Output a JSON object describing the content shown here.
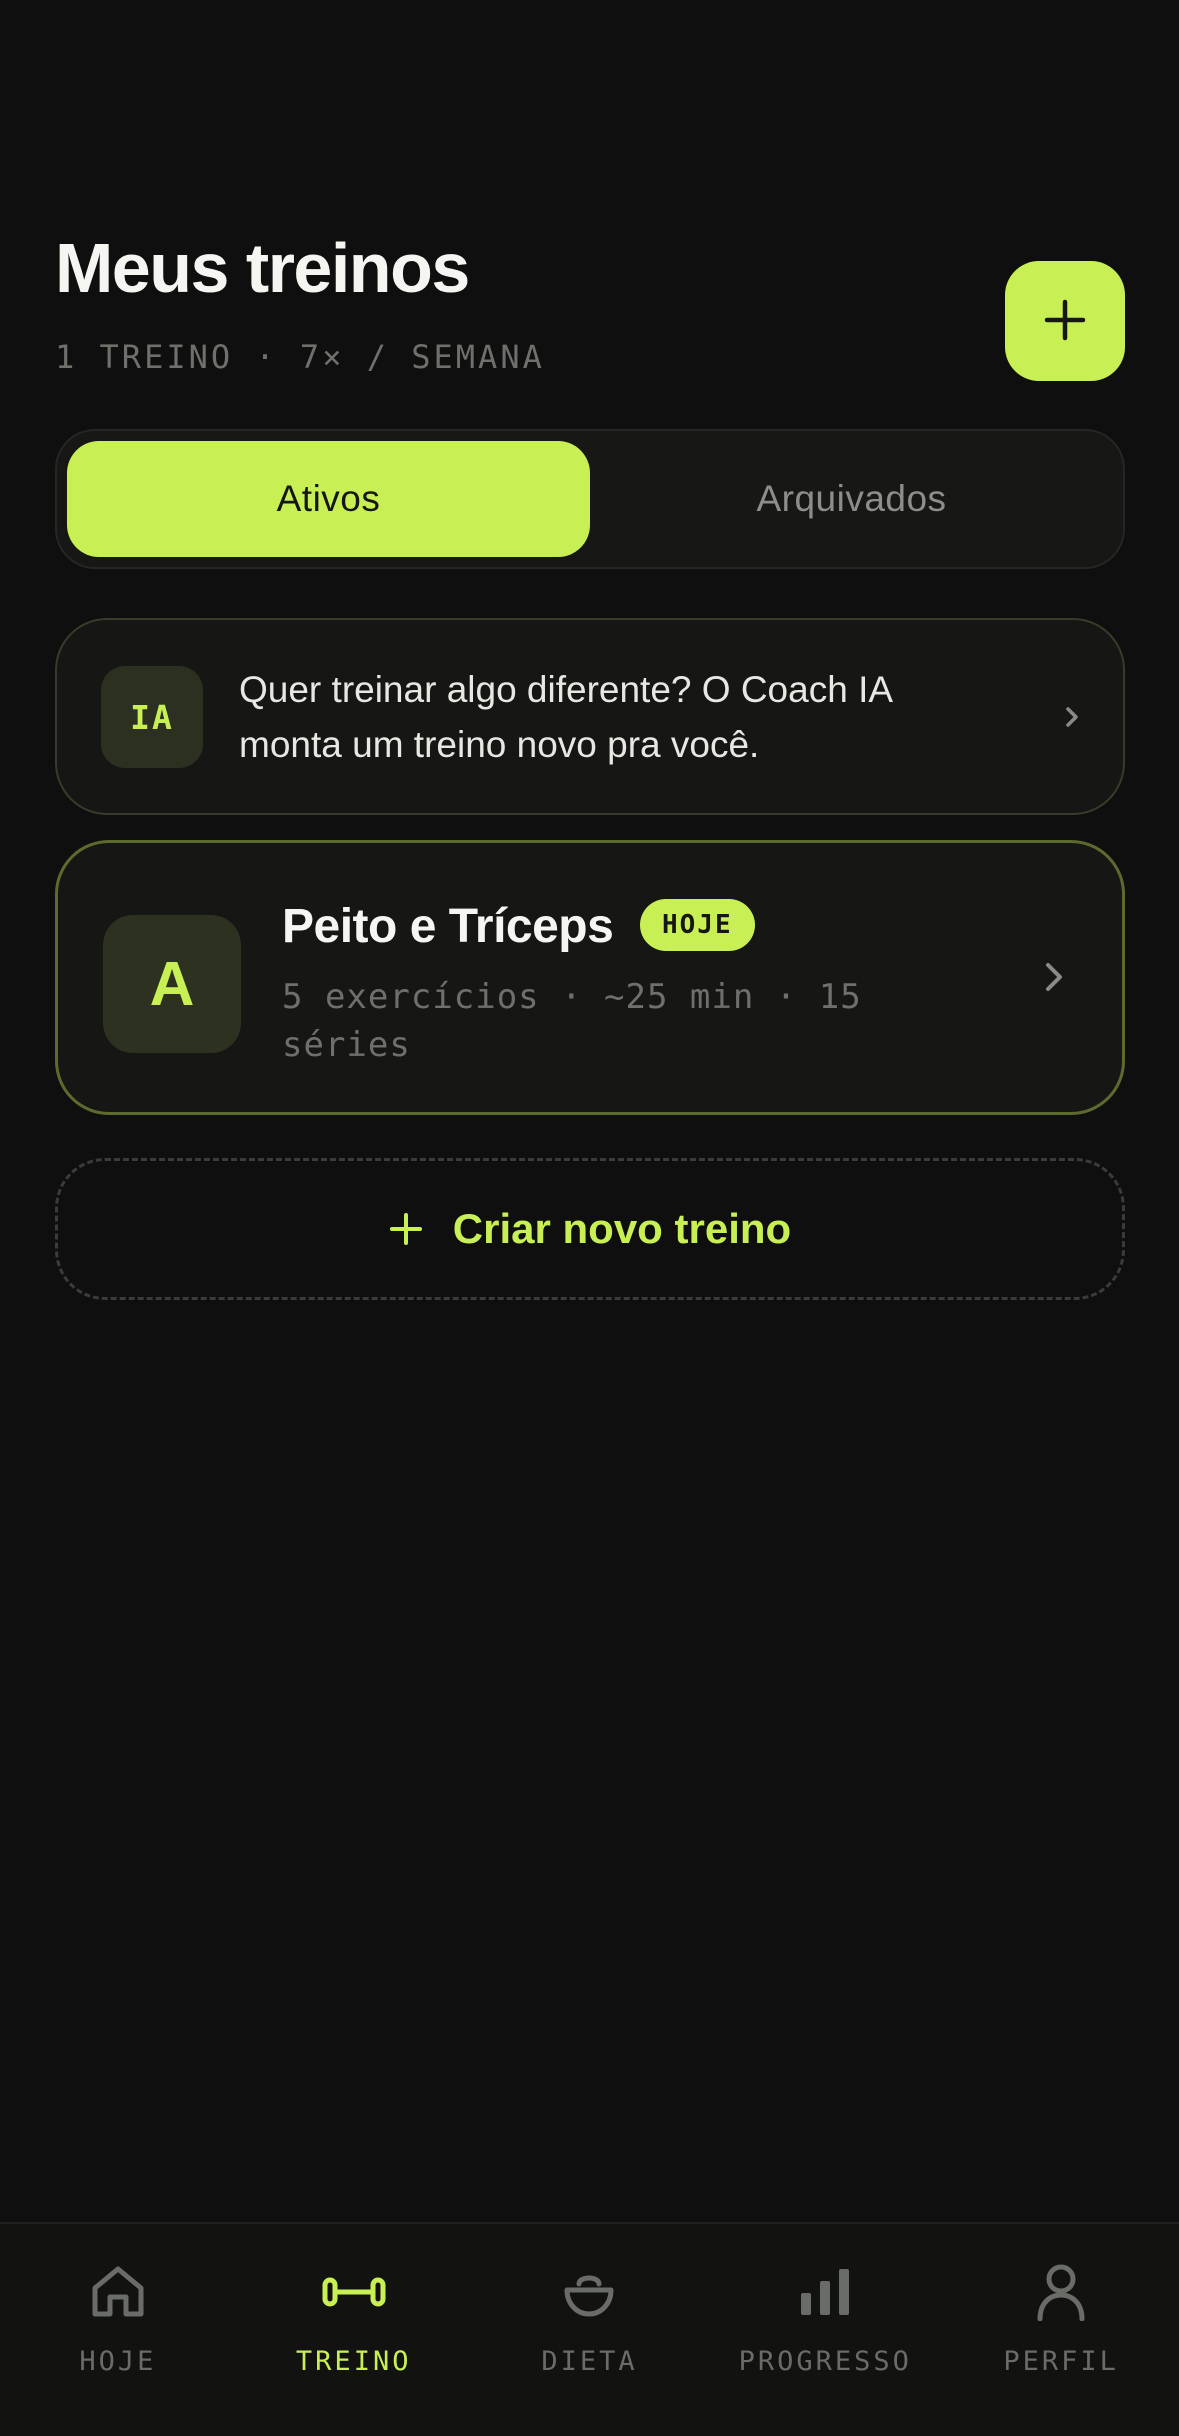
{
  "header": {
    "title": "Meus treinos",
    "subtitle": "1 TREINO · 7× / SEMANA"
  },
  "segmented": {
    "active": "Ativos",
    "inactive": "Arquivados"
  },
  "ai_card": {
    "badge": "IA",
    "text": "Quer treinar algo diferente? O Coach IA monta um treino novo pra você."
  },
  "workout": {
    "letter": "A",
    "name": "Peito e Tríceps",
    "badge": "HOJE",
    "meta": "5 exercícios · ~25 min · 15 séries"
  },
  "create": {
    "label": "Criar novo treino"
  },
  "tabbar": {
    "items": [
      {
        "label": "HOJE",
        "icon": "home-icon"
      },
      {
        "label": "TREINO",
        "icon": "dumbbell-icon",
        "active": true
      },
      {
        "label": "DIETA",
        "icon": "bowl-icon"
      },
      {
        "label": "PROGRESSO",
        "icon": "bar-chart-icon"
      },
      {
        "label": "PERFIL",
        "icon": "person-icon"
      }
    ]
  },
  "colors": {
    "accent": "#c8f055",
    "background": "#0e0f0e",
    "card": "#161714",
    "muted": "#6e706b"
  }
}
